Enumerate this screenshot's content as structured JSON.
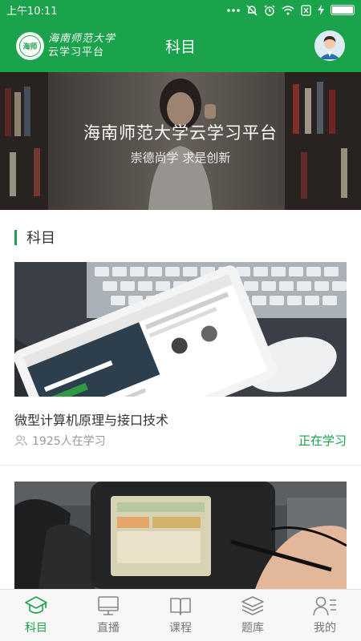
{
  "status_bar": {
    "time": "上午10:11",
    "icons": [
      "more-dots-icon",
      "bell-off-icon",
      "alarm-icon",
      "wifi-icon",
      "sim-off-icon",
      "charging-icon",
      "battery-icon"
    ],
    "battery_level": 1.0
  },
  "header": {
    "logo_seal_text": "海师",
    "logo_line1": "海南师范大学",
    "logo_line2": "云学习平台",
    "title": "科目",
    "avatar_icon": "user-avatar-icon"
  },
  "banner": {
    "title": "海南师范大学云学习平台",
    "subtitle": "崇德尚学 求是创新"
  },
  "section": {
    "title": "科目"
  },
  "courses": [
    {
      "title": "微型计算机原理与接口技术",
      "learners": "1925人在学习",
      "status": "正在学习"
    },
    {
      "title": "",
      "learners": "",
      "status": ""
    }
  ],
  "tabs": [
    {
      "label": "科目",
      "icon": "graduation-cap-icon",
      "active": true
    },
    {
      "label": "直播",
      "icon": "monitor-icon",
      "active": false
    },
    {
      "label": "课程",
      "icon": "book-icon",
      "active": false
    },
    {
      "label": "题库",
      "icon": "layers-icon",
      "active": false
    },
    {
      "label": "我的",
      "icon": "profile-icon",
      "active": false
    }
  ],
  "colors": {
    "accent": "#1aa34a",
    "text": "#333333",
    "muted": "#999999"
  }
}
